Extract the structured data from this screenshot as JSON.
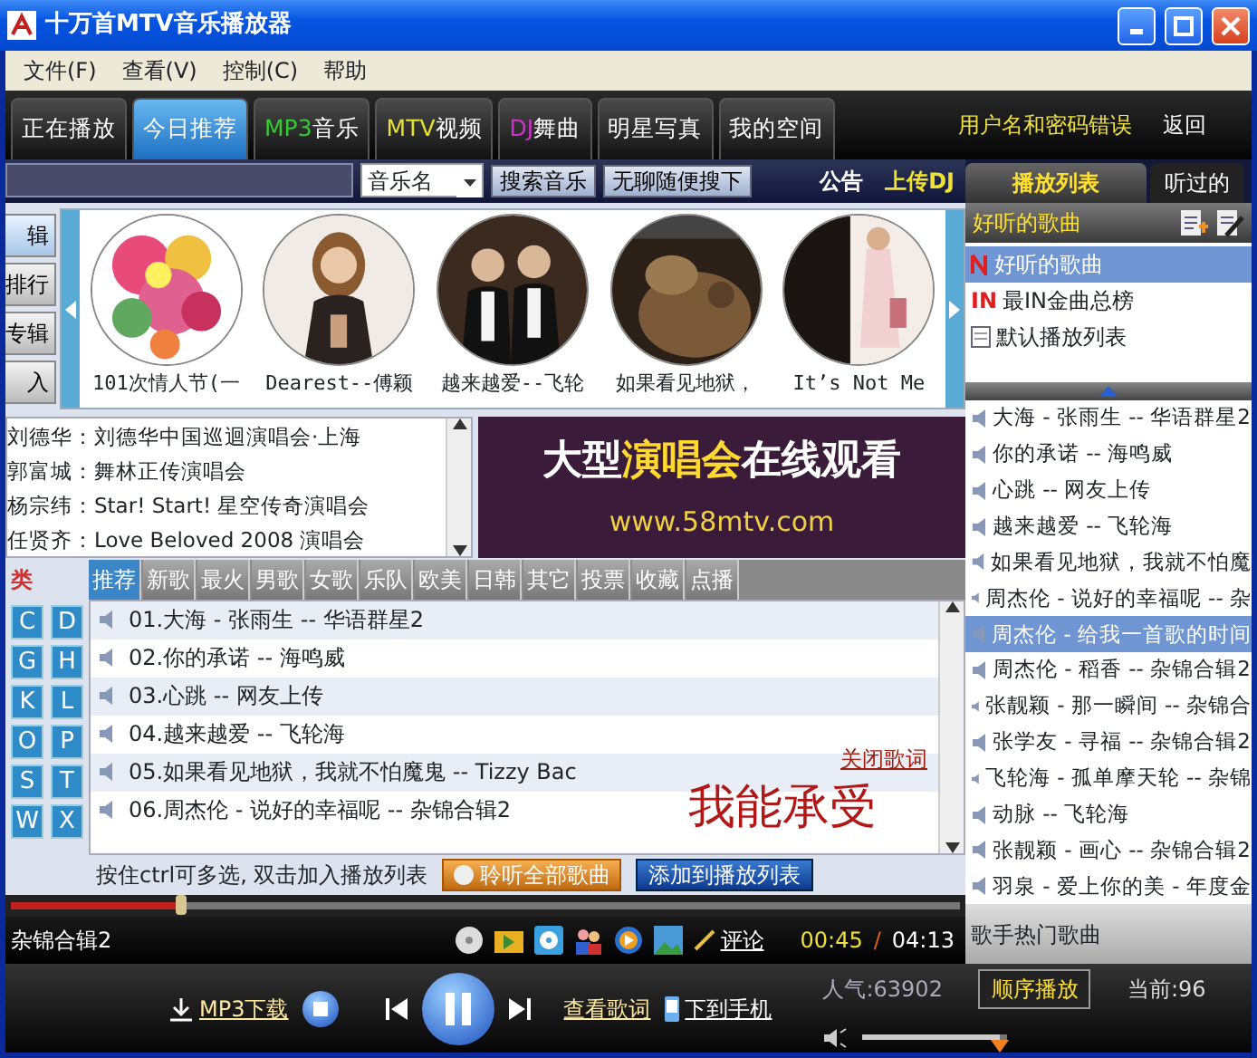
{
  "window": {
    "title": "十万首MTV音乐播放器"
  },
  "menu": [
    "文件(F)",
    "查看(V)",
    "控制(C)",
    "帮助"
  ],
  "nav_tabs": [
    {
      "label": "正在播放",
      "selected": false
    },
    {
      "label": "今日推荐",
      "selected": true
    },
    {
      "prefix": "MP3",
      "color": "#33cc33",
      "label": "音乐",
      "selected": false
    },
    {
      "prefix": "MTV",
      "color": "#e8e030",
      "label": "视频",
      "selected": false
    },
    {
      "prefix": "DJ",
      "color": "#d030d0",
      "label": "舞曲",
      "selected": false
    },
    {
      "label": "明星写真",
      "selected": false
    },
    {
      "label": "我的空间",
      "selected": false
    }
  ],
  "user_status": "用户名和密码错误",
  "back_link": "返回",
  "search": {
    "field_select": "音乐名",
    "buttons": [
      "搜索音乐",
      "无聊随便搜下"
    ]
  },
  "notice": "公告",
  "upload_dj": "上传DJ",
  "side_tabs": [
    {
      "label": "辑",
      "selected": true
    },
    {
      "label": "排行",
      "selected": false
    },
    {
      "label": "专辑",
      "selected": false
    },
    {
      "label": "入",
      "selected": false
    }
  ],
  "albums": [
    {
      "caption": "101次情人节(一"
    },
    {
      "caption": "Dearest--傅颖"
    },
    {
      "caption": "越来越爱--飞轮"
    },
    {
      "caption": "如果看见地狱，"
    },
    {
      "caption": "It’s Not Me"
    }
  ],
  "concerts": [
    "刘德华：刘德华中国巡迴演唱会·上海",
    "郭富城：舞林正传演唱会",
    "杨宗纬：Star! Start! 星空传奇演唱会",
    "任贤齐：Love Beloved 2008 演唱会"
  ],
  "banner": {
    "title_lead": "大型",
    "title_highlight": "演唱会",
    "title_tail": "在线观看",
    "url": "www.58mtv.com"
  },
  "category_label": "类",
  "letters": [
    "C",
    "D",
    "G",
    "H",
    "K",
    "L",
    "O",
    "P",
    "S",
    "T",
    "W",
    "X"
  ],
  "categories": [
    {
      "label": "推荐",
      "selected": true
    },
    {
      "label": "新歌",
      "selected": false
    },
    {
      "label": "最火",
      "selected": false
    },
    {
      "label": "男歌",
      "selected": false
    },
    {
      "label": "女歌",
      "selected": false
    },
    {
      "label": "乐队",
      "selected": false
    },
    {
      "label": "欧美",
      "selected": false
    },
    {
      "label": "日韩",
      "selected": false
    },
    {
      "label": "其它",
      "selected": false
    },
    {
      "label": "投票",
      "selected": false
    },
    {
      "label": "收藏",
      "selected": false
    },
    {
      "label": "点播",
      "selected": false
    }
  ],
  "songs": [
    "01.大海 - 张雨生 -- 华语群星2",
    "02.你的承诺 -- 海鸣威",
    "03.心跳 -- 网友上传",
    "04.越来越爱 -- 飞轮海",
    "05.如果看见地狱，我就不怕魔鬼 -- Tizzy Bac",
    "06.周杰伦 - 说好的幸福呢 -- 杂锦合辑2"
  ],
  "lyric": "我能承受",
  "close_lyrics": "关闭歌词",
  "hint": "按住ctrl可多选, 双击加入播放列表",
  "list_buttons": [
    "聆听全部歌曲",
    "添加到播放列表"
  ],
  "progress": {
    "level": 0.18
  },
  "now_playing": "杂锦合辑2",
  "comment": "评论",
  "elapsed": "00:45",
  "separator": "/",
  "duration": "04:13",
  "right_tabs": [
    {
      "label": "播放列表",
      "selected": true
    },
    {
      "label": "听过的",
      "selected": false
    }
  ],
  "playlist_header": "好听的歌曲",
  "playlists": [
    {
      "kind": "favorite",
      "label": "好听的歌曲",
      "selected": true
    },
    {
      "kind": "badge",
      "badge": "IN",
      "label": "最IN金曲总榜",
      "selected": false
    },
    {
      "kind": "list",
      "label": "默认播放列表",
      "selected": false
    }
  ],
  "playlist_songs": [
    {
      "title": "大海 - 张雨生 -- 华语群星2",
      "selected": false
    },
    {
      "title": "你的承诺 -- 海鸣威",
      "selected": false
    },
    {
      "title": "心跳 -- 网友上传",
      "selected": false
    },
    {
      "title": "越来越爱 -- 飞轮海",
      "selected": false
    },
    {
      "title": "如果看见地狱，我就不怕魔",
      "selected": false
    },
    {
      "title": "周杰伦 - 说好的幸福呢 -- 杂",
      "selected": false
    },
    {
      "title": "周杰伦 - 给我一首歌的时间",
      "selected": true
    },
    {
      "title": "周杰伦 - 稻香 -- 杂锦合辑2",
      "selected": false
    },
    {
      "title": "张靓颖 - 那一瞬间 -- 杂锦合",
      "selected": false
    },
    {
      "title": "张学友 - 寻福 -- 杂锦合辑2",
      "selected": false
    },
    {
      "title": "飞轮海 - 孤单摩天轮 -- 杂锦",
      "selected": false
    },
    {
      "title": "动脉 -- 飞轮海",
      "selected": false
    },
    {
      "title": "张靓颖 - 画心 -- 杂锦合辑2",
      "selected": false
    },
    {
      "title": "羽泉 - 爱上你的美 - 年度金",
      "selected": false
    }
  ],
  "singer_songs": "歌手热门歌曲",
  "bottom": {
    "mp3_download": "MP3下载",
    "view_lyrics": "查看歌词",
    "to_phone": "下到手机",
    "popularity": "人气:63902",
    "play_mode": "顺序播放",
    "current": "当前:96"
  },
  "volume": {
    "level": 0.95
  }
}
